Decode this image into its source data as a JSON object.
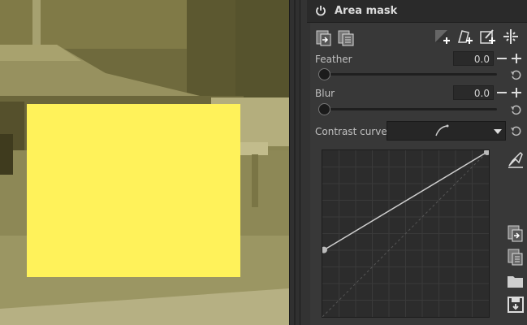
{
  "panel": {
    "title": "Area mask",
    "feather": {
      "label": "Feather",
      "value": "0.0",
      "level": 0
    },
    "blur": {
      "label": "Blur",
      "value": "0.0",
      "level": 0
    },
    "contrast_curve": {
      "label": "Contrast curve:"
    },
    "curve": {
      "points": [
        [
          0,
          0.4
        ],
        [
          1,
          1
        ]
      ]
    }
  },
  "colors": {
    "mask": "#fff25a",
    "panel_bg": "#383838",
    "header_bg": "#2a2a2a"
  },
  "icons": {
    "header": "power-icon",
    "toolbar": [
      "paste-mask-icon",
      "copy-mask-icon",
      "add-area-shape-icon",
      "add-mask-shape-icon",
      "add-mask-edit-icon",
      "split-tool-icon"
    ],
    "curve_side": [
      "picker-icon",
      "paste-icon",
      "copy-icon",
      "open-folder-icon",
      "save-icon"
    ]
  }
}
